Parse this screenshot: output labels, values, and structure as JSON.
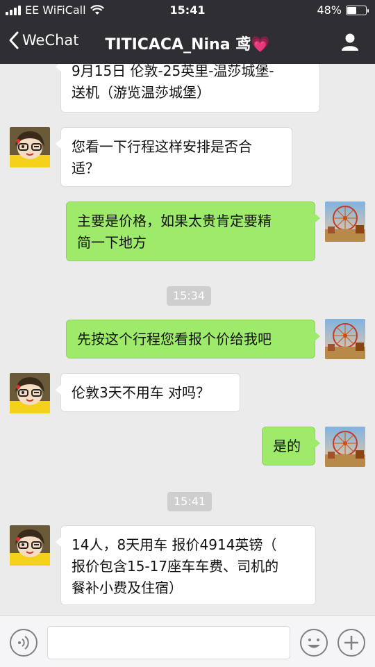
{
  "status_bar": {
    "carrier": "EE WiFiCall",
    "time": "15:41",
    "battery": "48%",
    "battery_level": 0.48
  },
  "nav": {
    "back_label": "WeChat",
    "title": "TITICACA_Nina 鸢💗"
  },
  "messages": [
    {
      "side": "in",
      "lines": [
        "9月15日 伦敦-25英里-温莎城堡-",
        "送机（游览温莎城堡）"
      ]
    },
    {
      "side": "in",
      "lines": [
        "您看一下行程这样安排是否合",
        "适？"
      ]
    },
    {
      "side": "out",
      "lines": [
        "主要是价格，如果太贵肯定要精",
        "简一下地方"
      ]
    },
    {
      "side": "timestamp",
      "text": "15:34"
    },
    {
      "side": "out",
      "lines": [
        "先按这个行程您看报个价给我吧"
      ]
    },
    {
      "side": "in",
      "lines": [
        "伦敦3天不用车 对吗？"
      ]
    },
    {
      "side": "out",
      "lines": [
        "是的"
      ]
    },
    {
      "side": "timestamp",
      "text": "15:41"
    },
    {
      "side": "in",
      "lines": [
        "14人，8天用车 报价4914英镑（",
        "报价包含15-17座车车费、司机的",
        "餐补小费及住宿）"
      ]
    }
  ],
  "icons": {
    "back": "chevron-left-icon",
    "profile": "person-icon",
    "voice": "voice-icon",
    "emoji": "emoji-icon",
    "more": "plus-icon"
  },
  "colors": {
    "header": "#2f2f33",
    "chat_bg": "#ebebeb",
    "outgoing_bubble": "#9eea6a",
    "incoming_bubble": "#ffffff",
    "timestamp_bg": "#cecece"
  }
}
